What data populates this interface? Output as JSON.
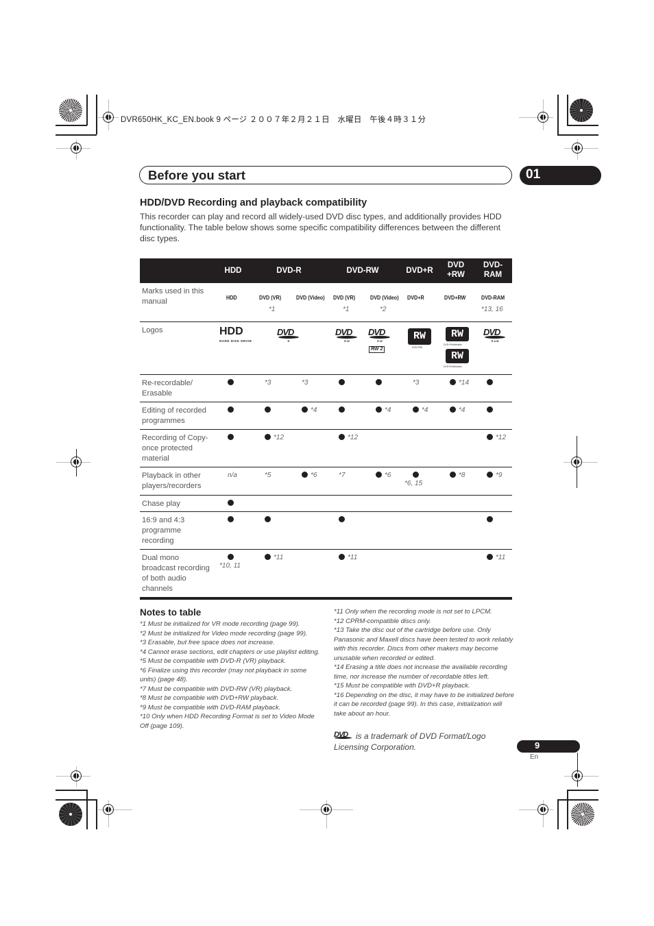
{
  "file_header": "DVR650HK_KC_EN.book  9 ページ  ２００７年２月２１日　水曜日　午後４時３１分",
  "header": {
    "title": "Before you start",
    "chapter": "01"
  },
  "section": {
    "heading": "HDD/DVD Recording and playback compatibility",
    "intro": "This recorder can play and record all widely-used DVD disc types, and additionally provides HDD functionality. The table below shows some specific compatibility differences between the different disc types."
  },
  "table": {
    "columns": [
      "HDD",
      "DVD-R",
      "DVD-RW",
      "DVD+R",
      "DVD\n+RW",
      "DVD-\nRAM"
    ],
    "column_labels": {
      "hdd": "HDD",
      "dvdr": "DVD-R",
      "dvdrw": "DVD-RW",
      "dvdpr": "DVD+R",
      "dvdprw_1": "DVD",
      "dvdprw_2": "+RW",
      "dvdram_1": "DVD-",
      "dvdram_2": "RAM"
    },
    "marks_row": {
      "label": "Marks used in this manual",
      "marks": [
        "HDD",
        "DVD (VR)",
        "DVD (Video)",
        "DVD (VR)",
        "DVD (Video)",
        "DVD+R",
        "DVD+RW",
        "DVD-RAM"
      ],
      "notes": [
        "",
        "*1",
        "",
        "*1",
        "*2",
        "",
        "",
        "*13, 16"
      ]
    },
    "logos_row": {
      "label": "Logos",
      "hdd_logo": "HDD",
      "hdd_logo_sub": "HARD DISK DRIVE",
      "dvd_logo": "DVD",
      "dvdr_sub": "R",
      "dvdrw_sub": "R W",
      "dvdram_sub": "R A M",
      "rw2": "RW 2",
      "rw": "RW",
      "rw_sub_1": "DVD+RW",
      "rw_sub_2": "DVD+ReWritable",
      "rw_sub_3": "DVD+ReWritable"
    },
    "rows": [
      {
        "label": "Re-recordable/ Erasable",
        "cells": [
          {
            "dot": true,
            "note": ""
          },
          {
            "dot": false,
            "note": "*3"
          },
          {
            "dot": false,
            "note": "*3"
          },
          {
            "dot": true,
            "note": ""
          },
          {
            "dot": true,
            "note": ""
          },
          {
            "dot": false,
            "note": "*3"
          },
          {
            "dot": true,
            "note": "*14"
          },
          {
            "dot": true,
            "note": ""
          }
        ]
      },
      {
        "label": "Editing of recorded programmes",
        "cells": [
          {
            "dot": true,
            "note": ""
          },
          {
            "dot": true,
            "note": ""
          },
          {
            "dot": true,
            "note": "*4"
          },
          {
            "dot": true,
            "note": ""
          },
          {
            "dot": true,
            "note": "*4"
          },
          {
            "dot": true,
            "note": "*4"
          },
          {
            "dot": true,
            "note": "*4"
          },
          {
            "dot": true,
            "note": ""
          }
        ]
      },
      {
        "label": "Recording of Copy-once protected material",
        "cells": [
          {
            "dot": true,
            "note": ""
          },
          {
            "dot": true,
            "note": "*12"
          },
          {
            "dot": false,
            "note": ""
          },
          {
            "dot": true,
            "note": "*12"
          },
          {
            "dot": false,
            "note": ""
          },
          {
            "dot": false,
            "note": ""
          },
          {
            "dot": false,
            "note": ""
          },
          {
            "dot": true,
            "note": "*12"
          }
        ]
      },
      {
        "label": "Playback in other players/recorders",
        "cells": [
          {
            "dot": false,
            "note": "n/a"
          },
          {
            "dot": false,
            "note": "*5"
          },
          {
            "dot": true,
            "note": "*6"
          },
          {
            "dot": false,
            "note": "*7"
          },
          {
            "dot": true,
            "note": "*6"
          },
          {
            "dot": true,
            "note": "*6, 15",
            "below": true
          },
          {
            "dot": true,
            "note": "*8"
          },
          {
            "dot": true,
            "note": "*9"
          }
        ]
      },
      {
        "label": "Chase play",
        "cells": [
          {
            "dot": true,
            "note": ""
          },
          {
            "dot": false,
            "note": ""
          },
          {
            "dot": false,
            "note": ""
          },
          {
            "dot": false,
            "note": ""
          },
          {
            "dot": false,
            "note": ""
          },
          {
            "dot": false,
            "note": ""
          },
          {
            "dot": false,
            "note": ""
          },
          {
            "dot": false,
            "note": ""
          }
        ]
      },
      {
        "label": "16:9 and 4:3 programme recording",
        "cells": [
          {
            "dot": true,
            "note": ""
          },
          {
            "dot": true,
            "note": ""
          },
          {
            "dot": false,
            "note": ""
          },
          {
            "dot": true,
            "note": ""
          },
          {
            "dot": false,
            "note": ""
          },
          {
            "dot": false,
            "note": ""
          },
          {
            "dot": false,
            "note": ""
          },
          {
            "dot": true,
            "note": ""
          }
        ]
      },
      {
        "label": "Dual mono broadcast recording of both audio channels",
        "cells": [
          {
            "dot": true,
            "note": "*10, 11",
            "below": true
          },
          {
            "dot": true,
            "note": "*11"
          },
          {
            "dot": false,
            "note": ""
          },
          {
            "dot": true,
            "note": "*11"
          },
          {
            "dot": false,
            "note": ""
          },
          {
            "dot": false,
            "note": ""
          },
          {
            "dot": false,
            "note": ""
          },
          {
            "dot": true,
            "note": "*11"
          }
        ]
      }
    ]
  },
  "notes": {
    "title": "Notes to table",
    "left": [
      "*1  Must be initialized for VR mode recording (page 99).",
      "*2  Must be initialized for Video mode recording (page 99).",
      "*3  Erasable, but free space does not increase.",
      "*4  Cannot erase sections, edit chapters or use playlist editing.",
      "*5  Must be compatible with DVD-R (VR) playback.",
      "*6  Finalize using this recorder (may not playback in some units) (page 48).",
      "*7  Must be compatible with DVD-RW (VR) playback.",
      "*8  Must be compatible with DVD+RW playback.",
      "*9  Must be compatible with DVD-RAM playback.",
      "*10  Only when HDD Recording Format is set to Video Mode Off (page 109)."
    ],
    "right": [
      "*11  Only when the recording mode is not set to LPCM.",
      "*12  CPRM-compatible discs only.",
      "*13  Take the disc out of the cartridge before use. Only Panasonic and Maxell discs have been tested to work reliably with this recorder. Discs from other makers may become unusable when recorded or edited.",
      "*14  Erasing a title does not increase the available recording time, nor increase the number of recordable titles left.",
      "*15  Must be compatible with DVD+R playback.",
      "*16  Depending on the disc, it may have to be initialized before it can be recorded (page 99). In this case, initialization will take about an hour."
    ],
    "trademark_logo": "DVD",
    "trademark_text": "is a trademark of DVD Format/Logo Licensing Corporation."
  },
  "footer": {
    "page_number": "9",
    "language": "En"
  }
}
